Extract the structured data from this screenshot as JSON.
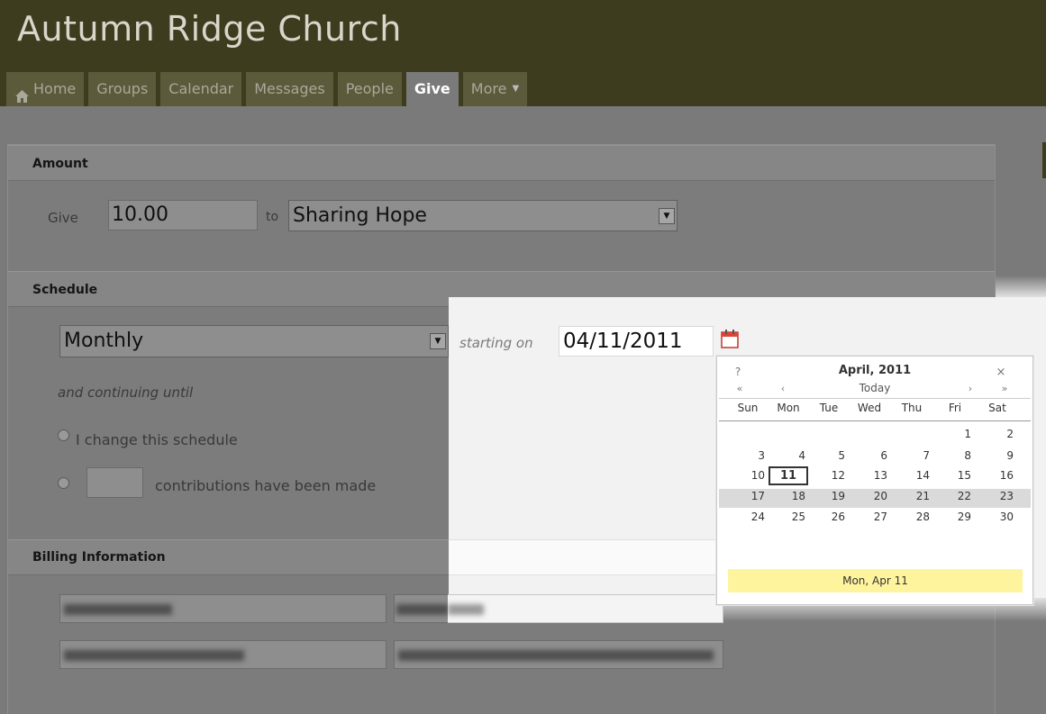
{
  "site": {
    "title": "Autumn Ridge Church"
  },
  "nav": {
    "tabs": [
      {
        "label": "Home",
        "icon": "home-icon"
      },
      {
        "label": "Groups"
      },
      {
        "label": "Calendar"
      },
      {
        "label": "Messages"
      },
      {
        "label": "People"
      },
      {
        "label": "Give",
        "active": true
      },
      {
        "label": "More",
        "icon": "dropdown-caret-icon"
      }
    ]
  },
  "amount": {
    "heading": "Amount",
    "give_label": "Give",
    "amount_value": "10.00",
    "to_label": "to",
    "fund_selected": "Sharing Hope"
  },
  "schedule": {
    "heading": "Schedule",
    "frequency_selected": "Monthly",
    "starting_label": "starting on",
    "start_date": "04/11/2011",
    "continuing_label": "and continuing until",
    "option_change": "I change this schedule",
    "option_count_suffix": "contributions have been made",
    "count_value": ""
  },
  "billing": {
    "heading": "Billing Information"
  },
  "calendar": {
    "help": "?",
    "title": "April, 2011",
    "close": "×",
    "prev_year": "«",
    "prev_month": "‹",
    "today": "Today",
    "next_month": "›",
    "next_year": "»",
    "day_names": [
      "Sun",
      "Mon",
      "Tue",
      "Wed",
      "Thu",
      "Fri",
      "Sat"
    ],
    "weeks": [
      [
        "",
        "",
        "",
        "",
        "",
        "1",
        "2"
      ],
      [
        "3",
        "4",
        "5",
        "6",
        "7",
        "8",
        "9"
      ],
      [
        "10",
        "11",
        "12",
        "13",
        "14",
        "15",
        "16"
      ],
      [
        "17",
        "18",
        "19",
        "20",
        "21",
        "22",
        "23"
      ],
      [
        "24",
        "25",
        "26",
        "27",
        "28",
        "29",
        "30"
      ]
    ],
    "selected_day": "11",
    "status": "Mon, Apr 11"
  },
  "colors": {
    "header_bg": "#3e3c1e",
    "tab_bg": "#5b5a3b",
    "status_bg": "#fff49e"
  }
}
